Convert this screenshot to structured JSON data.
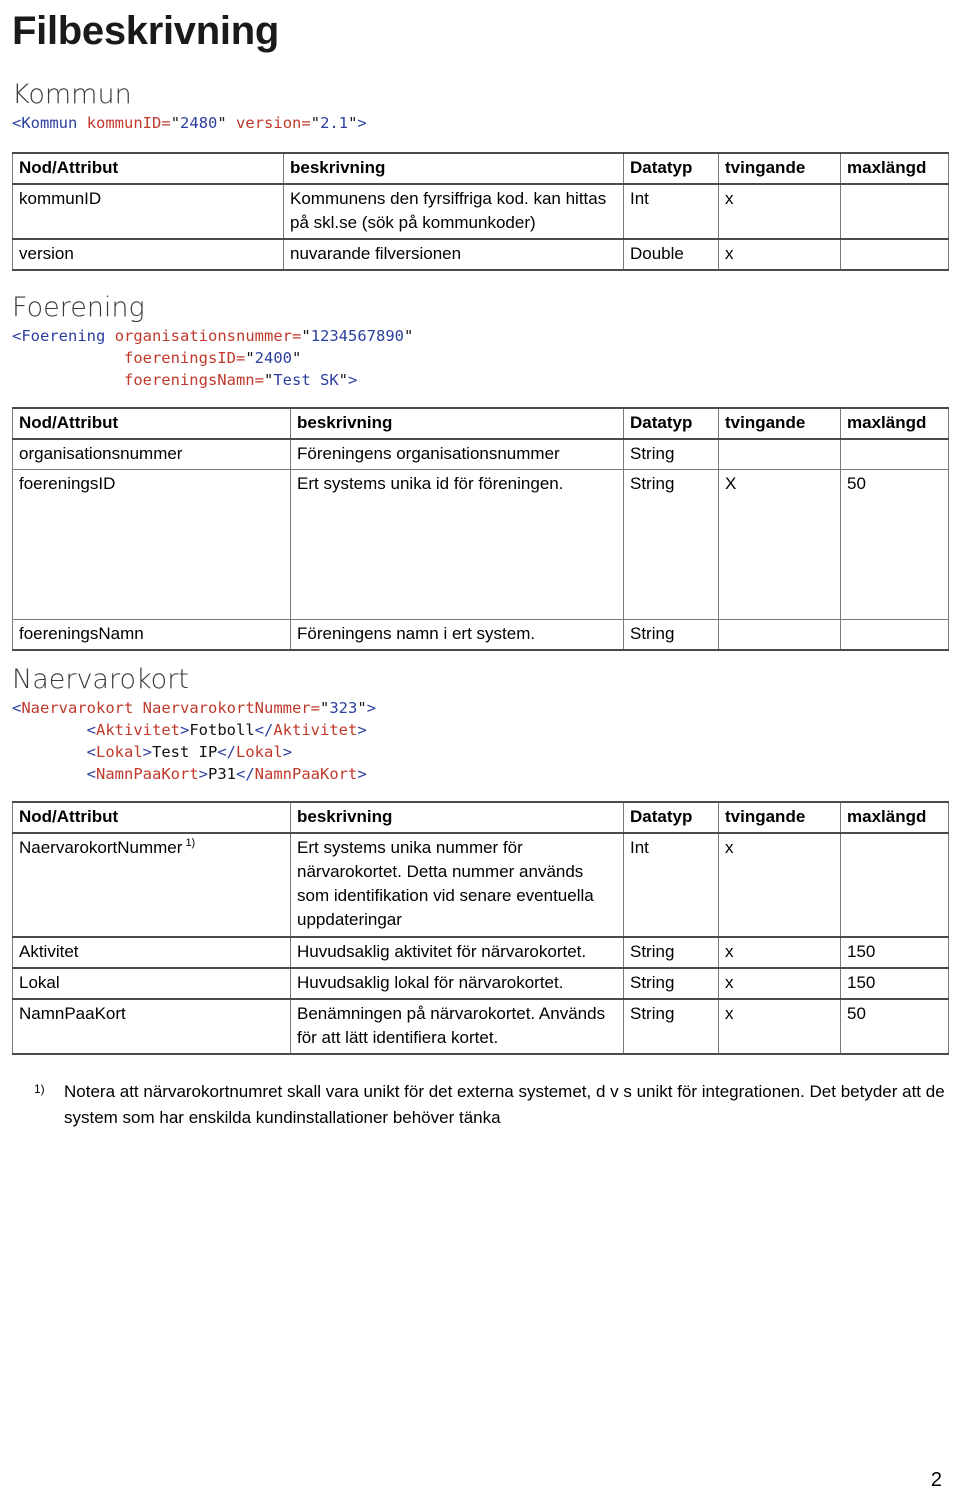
{
  "document": {
    "title": "Filbeskrivning",
    "page_number": "2"
  },
  "table_headers": {
    "node": "Nod/Attribut",
    "description": "beskrivning",
    "datatype": "Datatyp",
    "required": "tvingande",
    "maxlength": "maxlängd"
  },
  "sections": [
    {
      "heading": "Kommun",
      "code": {
        "line1_open": "<",
        "line1_tag": "Kommun",
        "line1_attr1": "kommunID",
        "line1_val1": "2480",
        "line1_attr2": "version",
        "line1_val2": "2.1",
        "line1_close": ">"
      },
      "rows": [
        {
          "node": "kommunID",
          "description": "Kommunens den fyrsiffriga kod. kan hittas på skl.se (sök på kommunkoder)",
          "datatype": "Int",
          "required": "x",
          "maxlength": ""
        },
        {
          "node": "version",
          "description": "nuvarande filversionen",
          "datatype": "Double",
          "required": "x",
          "maxlength": ""
        }
      ]
    },
    {
      "heading": "Foerening",
      "code": {
        "tag": "Foerening",
        "attr1": "organisationsnummer",
        "val1": "1234567890",
        "attr2": "foereningsID",
        "val2": "2400",
        "attr3": "foereningsNamn",
        "val3": "Test SK"
      },
      "rows": [
        {
          "node": "organisationsnummer",
          "description": "Föreningens organisationsnummer",
          "datatype": "String",
          "required": "",
          "maxlength": ""
        },
        {
          "node": "foereningsID",
          "description": "Ert systems unika id för föreningen.",
          "datatype": "String",
          "required": "X",
          "maxlength": "50"
        },
        {
          "node": "foereningsNamn",
          "description": "Föreningens namn i ert system.",
          "datatype": "String",
          "required": "",
          "maxlength": ""
        }
      ]
    },
    {
      "heading": "Naervarokort",
      "code": {
        "root_tag": "Naervarokort",
        "root_attr": "NaervarokortNummer",
        "root_val": "323",
        "child1_tag": "Aktivitet",
        "child1_text": "Fotboll",
        "child2_tag": "Lokal",
        "child2_text": "Test IP",
        "child3_tag": "NamnPaaKort",
        "child3_text": "P31"
      },
      "rows": [
        {
          "node": "NaervarokortNummer",
          "footnote_marker": "1)",
          "description": "Ert systems unika nummer för närvarokortet. Detta nummer används som identifikation vid senare eventuella uppdateringar",
          "datatype": "Int",
          "required": "x",
          "maxlength": ""
        },
        {
          "node": "Aktivitet",
          "description": "Huvudsaklig aktivitet för närvarokortet.",
          "datatype": "String",
          "required": "x",
          "maxlength": "150"
        },
        {
          "node": "Lokal",
          "description": "Huvudsaklig lokal för närvarokortet.",
          "datatype": "String",
          "required": "x",
          "maxlength": "150"
        },
        {
          "node": "NamnPaaKort",
          "description": "Benämningen på närvarokortet. Används för att lätt identifiera kortet.",
          "datatype": "String",
          "required": "x",
          "maxlength": "50"
        }
      ]
    }
  ],
  "footnote": {
    "marker": "1)",
    "text": "Notera att närvarokortnumret skall vara unikt för det externa systemet, d v s unikt för integrationen. Det betyder att de system som har enskilda kundinstallationer behöver tänka"
  },
  "colors": {
    "tag": "#2b3f9e",
    "attribute": "#c0392b",
    "value": "#2b3f9e",
    "heading": "#3a3a3a",
    "border": "#7a7a7a"
  }
}
